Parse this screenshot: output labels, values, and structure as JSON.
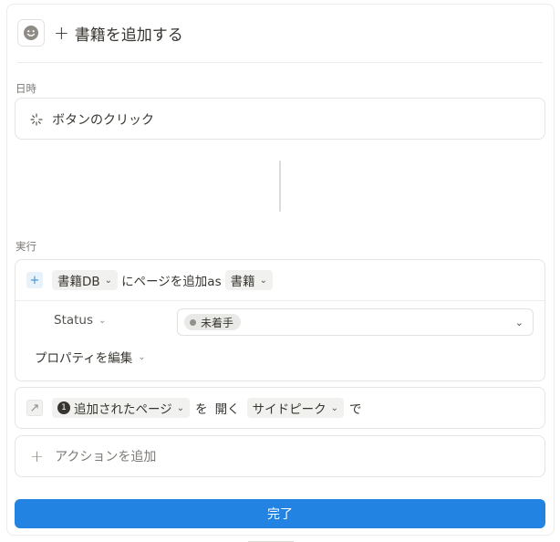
{
  "header": {
    "icon": "smiley-icon",
    "plus": "+",
    "title": "書籍を追加する"
  },
  "trigger": {
    "section_label": "日時",
    "icon": "sparkle-click-icon",
    "label": "ボタンのクリック"
  },
  "actions": {
    "section_label": "実行",
    "add_page": {
      "icon": "plus-icon",
      "database": "書籍DB",
      "middle_text": "にページを追加as",
      "template": "書籍",
      "property": {
        "name": "Status",
        "value": "未着手",
        "status_color": "#91918e"
      },
      "edit_properties": "プロパティを編集"
    },
    "open_page": {
      "icon": "arrow-up-right-icon",
      "badge": "1",
      "page_ref": "追加されたページ",
      "text_wo": "を",
      "text_open": "開く",
      "mode": "サイドピーク",
      "text_de": "で"
    },
    "add_action": {
      "plus": "+",
      "label": "アクションを追加"
    }
  },
  "footer": {
    "done_label": "完了",
    "accent_color": "#2383e2"
  }
}
